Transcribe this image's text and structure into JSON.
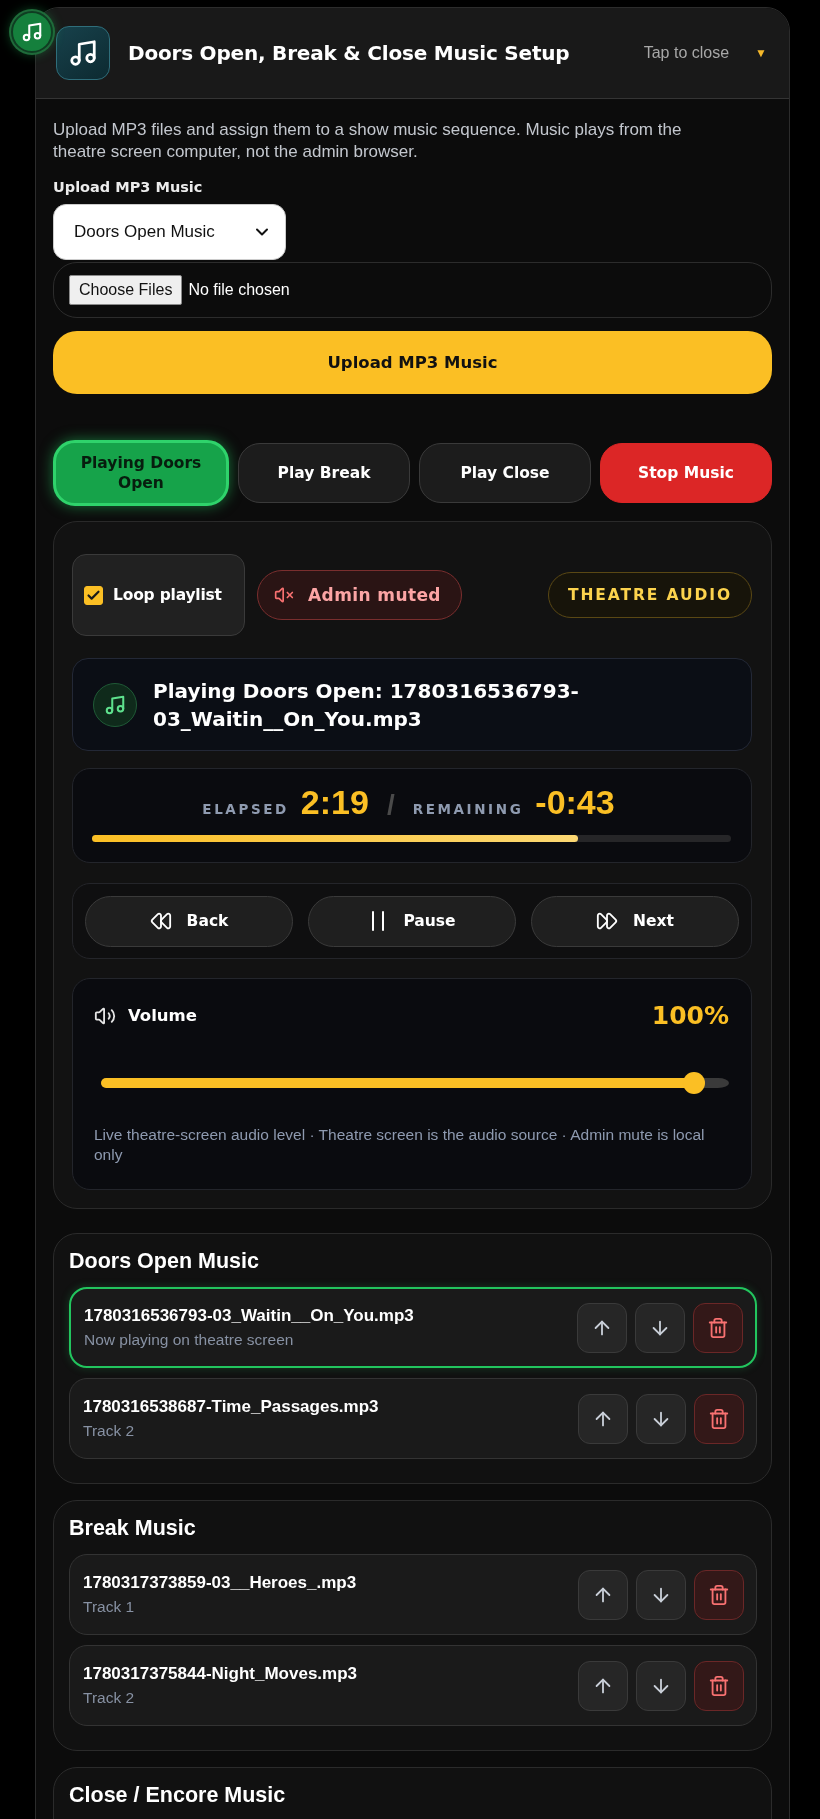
{
  "header": {
    "title": "Doors Open, Break & Close Music Setup",
    "toggle": "Tap to close",
    "caret": "▼"
  },
  "intro": "Upload MP3 files and assign them to a show music sequence. Music plays from the theatre screen computer, not the admin browser.",
  "upload": {
    "label": "Upload MP3 Music",
    "sequence": "Doors Open Music",
    "file_button": "Choose Files",
    "file_status": "No file chosen",
    "submit": "Upload MP3 Music"
  },
  "play_buttons": [
    {
      "label": "Playing Doors Open",
      "kind": "play",
      "selected": true
    },
    {
      "label": "Play Break",
      "kind": "play",
      "selected": false
    },
    {
      "label": "Play Close",
      "kind": "play",
      "selected": false
    },
    {
      "label": "Stop Music",
      "kind": "stop",
      "selected": false
    }
  ],
  "player": {
    "loop": {
      "label": "Loop playlist",
      "checked": true
    },
    "admin_mute": {
      "label": "Admin muted",
      "muted": true
    },
    "output_badge": "THEATRE AUDIO",
    "now_playing": "Playing Doors Open: 1780316536793-03_Waitin__On_You.mp3",
    "elapsed_label": "ELAPSED",
    "elapsed": "2:19",
    "separator": "/",
    "remaining_label": "REMAINING",
    "remaining": "-0:43",
    "progress": {
      "level": 0.76
    },
    "transport": [
      {
        "label": "Back",
        "kind": "back"
      },
      {
        "label": "Pause",
        "kind": "pause"
      },
      {
        "label": "Next",
        "kind": "next"
      }
    ],
    "volume": {
      "label": "Volume",
      "reading": "100%",
      "level": 0.96,
      "note": "Live theatre-screen audio level · Theatre screen is the audio source · Admin mute is local only"
    }
  },
  "sections": [
    {
      "title": "Doors Open Music",
      "tracks": [
        {
          "name": "1780316536793-03_Waitin__On_You.mp3",
          "status": "Now playing on theatre screen",
          "playing": true
        },
        {
          "name": "1780316538687-Time_Passages.mp3",
          "status": "Track 2",
          "playing": false
        }
      ]
    },
    {
      "title": "Break Music",
      "tracks": [
        {
          "name": "1780317373859-03__Heroes_.mp3",
          "status": "Track 1",
          "playing": false
        },
        {
          "name": "1780317375844-Night_Moves.mp3",
          "status": "Track 2",
          "playing": false
        }
      ]
    },
    {
      "title": "Close / Encore Music"
    }
  ]
}
